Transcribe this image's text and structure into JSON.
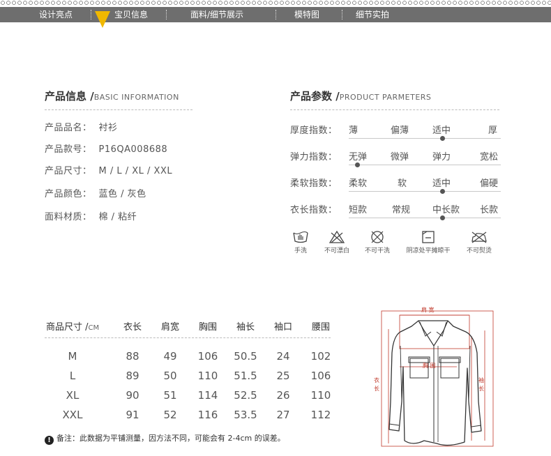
{
  "nav": {
    "items": [
      "设计亮点",
      "宝贝信息",
      "面料/细节展示",
      "模特图",
      "细节实拍"
    ],
    "active_index": 1,
    "accent": "#f0b800"
  },
  "basic_info": {
    "title": "产品信息 /",
    "title_en": "BASIC INFORMATION",
    "rows": [
      {
        "label": "产品品名：",
        "value": "衬衫"
      },
      {
        "label": "产品款号：",
        "value": "P16QA008688"
      },
      {
        "label": "产品尺寸：",
        "value": "M / L / XL / XXL"
      },
      {
        "label": "产品颜色：",
        "value": "蓝色 / 灰色"
      },
      {
        "label": "面料材质：",
        "value": "棉 / 粘纤"
      }
    ]
  },
  "params": {
    "title": "产品参数 /",
    "title_en": "PRODUCT PARMETERS",
    "rows": [
      {
        "label": "厚度指数：",
        "options": [
          "薄",
          "偏薄",
          "适中",
          "厚"
        ],
        "selected": 2
      },
      {
        "label": "弹力指数：",
        "options": [
          "无弹",
          "微弹",
          "弹力",
          "宽松"
        ],
        "selected": 0
      },
      {
        "label": "柔软指数：",
        "options": [
          "柔软",
          "软",
          "适中",
          "偏硬"
        ],
        "selected": 2
      },
      {
        "label": "衣长指数：",
        "options": [
          "短款",
          "常规",
          "中长款",
          "长款"
        ],
        "selected": 2
      }
    ]
  },
  "care": [
    {
      "icon": "hand-wash-icon",
      "label": "手洗"
    },
    {
      "icon": "no-bleach-icon",
      "label": "不可漂白"
    },
    {
      "icon": "no-dry-clean-icon",
      "label": "不可干洗"
    },
    {
      "icon": "shade-flat-dry-icon",
      "label": "阴凉处平摊晾干"
    },
    {
      "icon": "no-iron-icon",
      "label": "不可熨烫"
    }
  ],
  "size_table": {
    "header_first": "商品尺寸 /",
    "header_unit": "CM",
    "columns": [
      "衣长",
      "肩宽",
      "胸围",
      "袖长",
      "袖口",
      "腰围"
    ],
    "rows": [
      {
        "size": "M",
        "values": [
          "88",
          "49",
          "106",
          "50.5",
          "24",
          "102"
        ]
      },
      {
        "size": "L",
        "values": [
          "89",
          "50",
          "110",
          "51.5",
          "25",
          "106"
        ]
      },
      {
        "size": "XL",
        "values": [
          "90",
          "51",
          "114",
          "52.5",
          "26",
          "110"
        ]
      },
      {
        "size": "XXL",
        "values": [
          "91",
          "52",
          "116",
          "53.5",
          "27",
          "112"
        ]
      }
    ],
    "note": "备注：此数据为平铺测量，因方法不同，可能会有 2-4cm 的误差。",
    "note_icon": "!"
  },
  "diagram": {
    "shoulder_label": "肩 宽",
    "chest_label": "胸 围",
    "length_label_1": "衣",
    "length_label_2": "长",
    "sleeve_label_1": "袖",
    "sleeve_label_2": "长",
    "line_color": "#c0392b"
  }
}
